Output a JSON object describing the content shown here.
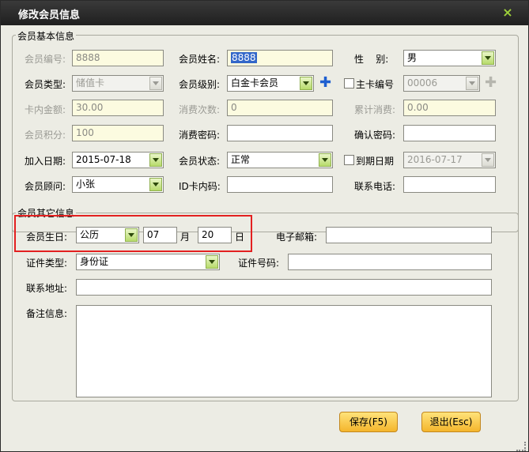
{
  "window": {
    "title": "修改会员信息",
    "close_glyph": "×"
  },
  "basic": {
    "legend": "会员基本信息",
    "member_no": {
      "label": "会员编号:",
      "value": "8888"
    },
    "member_name": {
      "label": "会员姓名:",
      "value": "8888"
    },
    "gender": {
      "label": "性    别:",
      "value": "男"
    },
    "member_type": {
      "label": "会员类型:",
      "value": "储值卡"
    },
    "member_level": {
      "label": "会员级别:",
      "value": "白金卡会员"
    },
    "main_card": {
      "label": "主卡编号",
      "value": "00006"
    },
    "card_amount": {
      "label": "卡内金额:",
      "value": "30.00"
    },
    "consume_count": {
      "label": "消费次数:",
      "value": "0"
    },
    "total_consume": {
      "label": "累计消费:",
      "value": "0.00"
    },
    "points": {
      "label": "会员积分:",
      "value": "100"
    },
    "consume_pwd": {
      "label": "消费密码:",
      "value": ""
    },
    "confirm_pwd": {
      "label": "确认密码:",
      "value": ""
    },
    "join_date": {
      "label": "加入日期:",
      "value": "2015-07-18"
    },
    "member_status": {
      "label": "会员状态:",
      "value": "正常"
    },
    "expire_date": {
      "label": "到期日期",
      "value": "2016-07-17"
    },
    "consultant": {
      "label": "会员顾问:",
      "value": "小张"
    },
    "id_card_code": {
      "label": "ID卡内码:",
      "value": ""
    },
    "phone": {
      "label": "联系电话:",
      "value": ""
    }
  },
  "other": {
    "legend": "会员其它信息",
    "birthday": {
      "label": "会员生日:",
      "calendar": "公历",
      "month": "07",
      "month_unit": "月",
      "day": "20",
      "day_unit": "日"
    },
    "email": {
      "label": "电子邮箱:",
      "value": ""
    },
    "id_type": {
      "label": "证件类型:",
      "value": "身份证"
    },
    "id_number": {
      "label": "证件号码:",
      "value": ""
    },
    "address": {
      "label": "联系地址:",
      "value": ""
    },
    "remarks": {
      "label": "备注信息:",
      "value": ""
    }
  },
  "buttons": {
    "save": "保存(F5)",
    "exit": "退出(Esc)"
  },
  "colors": {
    "titlebar": "#2a2a2a",
    "highlight_box": "#e32020",
    "button": "#f4b52c",
    "plus_icon": "#1e5fd0"
  }
}
